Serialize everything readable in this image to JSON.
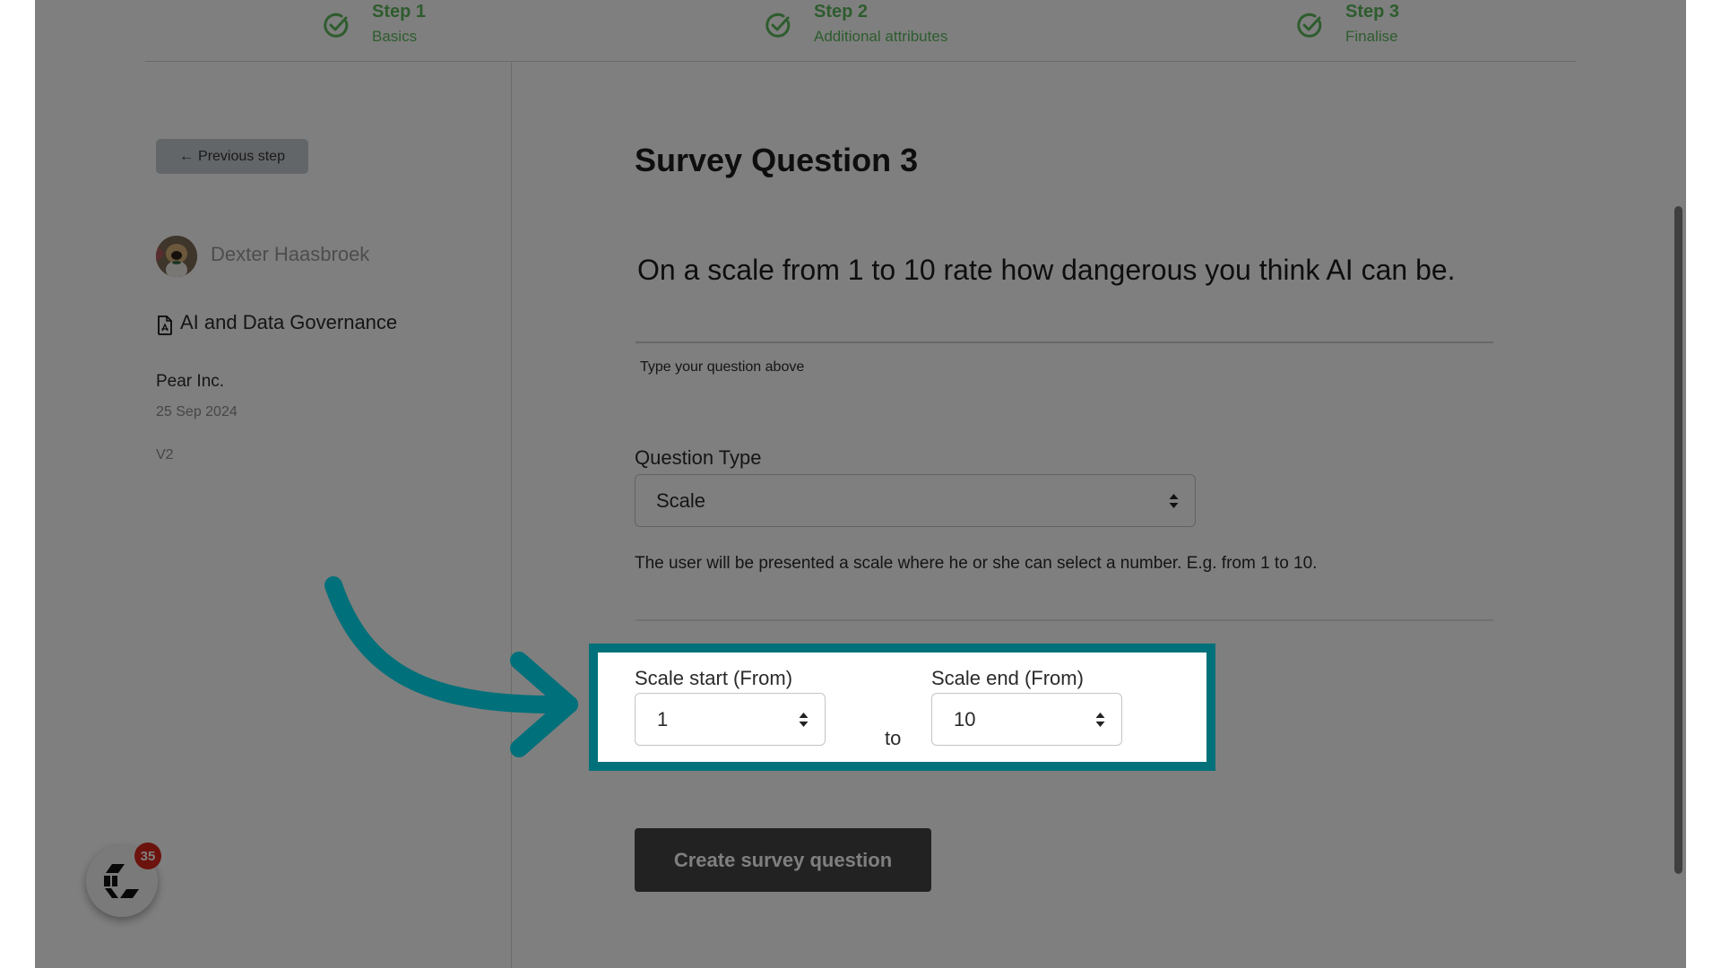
{
  "steps": [
    {
      "title": "Step 1",
      "subtitle": "Basics",
      "status": "complete",
      "icon": "check-circle-icon"
    },
    {
      "title": "Step 2",
      "subtitle": "Additional attributes",
      "status": "complete",
      "icon": "check-circle-icon"
    },
    {
      "title": "Step 3",
      "subtitle": "Finalise",
      "status": "complete",
      "icon": "check-circle-icon"
    }
  ],
  "sidebar": {
    "previous_step_label": "Previous step",
    "previous_step_icon": "arrow-left-icon",
    "user_name": "Dexter Haasbroek",
    "document_name": "AI and Data Governance",
    "document_icon": "file-pdf-icon",
    "organization": "Pear Inc.",
    "date": "25 Sep 2024",
    "version": "V2"
  },
  "main": {
    "title": "Survey Question 3",
    "question_text": "On a scale from 1 to 10 rate how dangerous you think AI can be.",
    "question_hint": "Type your question above",
    "question_type_label": "Question Type",
    "question_type_value": "Scale",
    "question_type_description": "The user will be presented a scale where he or she can select a number. E.g. from 1 to 10.",
    "scale_start_label": "Scale start (From)",
    "scale_start_value": "1",
    "scale_to_label": "to",
    "scale_end_label": "Scale end (From)",
    "scale_end_value": "10",
    "create_button_label": "Create survey question"
  },
  "chat_widget": {
    "badge_count": "35"
  },
  "colors": {
    "step_complete": "#5cb85c",
    "highlight": "#00707a",
    "badge": "#d9261c",
    "primary_button": "#454545"
  }
}
